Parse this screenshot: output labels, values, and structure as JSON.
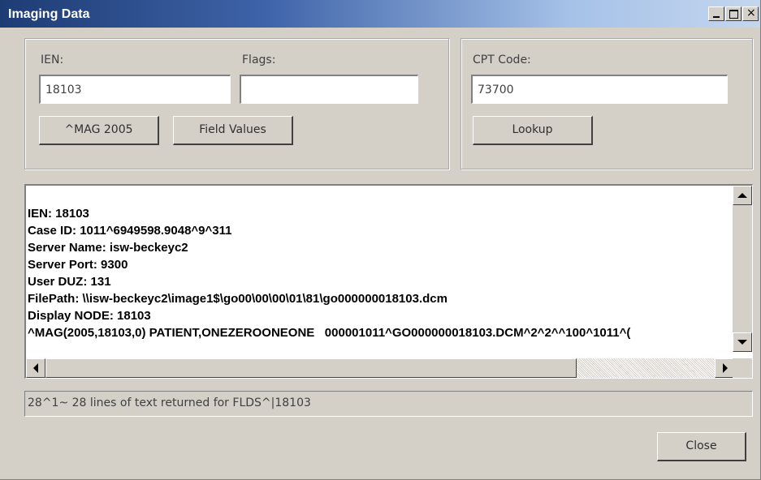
{
  "window": {
    "title": "Imaging Data"
  },
  "ien": {
    "label": "IEN:",
    "value": "18103"
  },
  "flags": {
    "label": "Flags:",
    "value": ""
  },
  "cpt": {
    "label": "CPT Code:",
    "value": "73700"
  },
  "buttons": {
    "mag": "^MAG 2005",
    "field_values": "Field Values",
    "lookup": "Lookup",
    "close": "Close"
  },
  "output": {
    "lines": [
      "IEN: 18103",
      "Case ID: 1011^6949598.9048^9^311",
      "Server Name: isw-beckeyc2",
      "Server Port: 9300",
      "User DUZ: 131",
      "FilePath: \\\\isw-beckeyc2\\image1$\\go00\\00\\00\\01\\81\\go000000018103.dcm",
      "Display NODE: 18103",
      "^MAG(2005,18103,0) PATIENT,ONEZEROONEONE   000001011^GO000000018103.DCM^2^2^^100^1011^("
    ]
  },
  "status": {
    "text": "28^1~ 28 lines of text returned for FLDS^|18103"
  },
  "icons": [
    "minimize-icon",
    "maximize-icon",
    "close-icon",
    "scroll-up-arrow-icon",
    "scroll-down-arrow-icon",
    "scroll-left-arrow-icon",
    "scroll-right-arrow-icon"
  ]
}
